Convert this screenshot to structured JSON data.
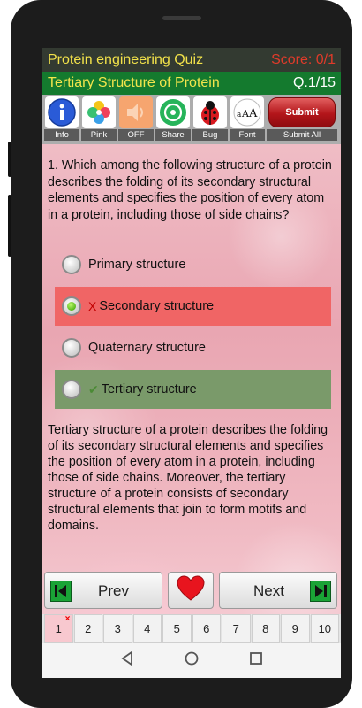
{
  "header": {
    "app_title": "Protein engineering Quiz",
    "score": "Score: 0/1",
    "topic": "Tertiary Structure of Protein",
    "question_number": "Q.1/15"
  },
  "toolbar": {
    "items": [
      {
        "label": "Info",
        "icon": "info-icon"
      },
      {
        "label": "Pink",
        "icon": "color-palette-icon"
      },
      {
        "label": "OFF",
        "icon": "speaker-icon"
      },
      {
        "label": "Share",
        "icon": "share-icon"
      },
      {
        "label": "Bug",
        "icon": "ladybug-icon"
      },
      {
        "label": "Font",
        "icon": "font-size-icon"
      }
    ],
    "submit_button": "Submit",
    "submit_all_label": "Submit All"
  },
  "question": {
    "text": "1. Which among the following structure of a protein describes the folding of its secondary structural elements and specifies the position of every atom in a protein, including those of side chains?",
    "options": [
      {
        "label": "Primary structure",
        "state": "default"
      },
      {
        "label": "Secondary structure",
        "state": "wrong-selected",
        "mark": "X"
      },
      {
        "label": "Quaternary structure",
        "state": "default"
      },
      {
        "label": "Tertiary structure",
        "state": "correct",
        "mark": "✔"
      }
    ],
    "explanation": "Tertiary structure of a protein describes the folding of its secondary structural elements and specifies the position of every atom in a protein, including those of side chains. Moreover, the tertiary structure of a protein consists of secondary structural elements that join to form motifs and domains."
  },
  "navigation": {
    "prev_label": "Prev",
    "next_label": "Next",
    "favorite_icon": "heart-icon"
  },
  "pages": {
    "items": [
      "1",
      "2",
      "3",
      "4",
      "5",
      "6",
      "7",
      "8",
      "9",
      "10"
    ],
    "current": "1",
    "wrong_marker": "×"
  },
  "colors": {
    "title_text": "#f2e24a",
    "score_text": "#e03b2a",
    "topic_bar": "#147a2e",
    "wrong_option": "#f06565",
    "correct_option": "#7a9a6a"
  }
}
